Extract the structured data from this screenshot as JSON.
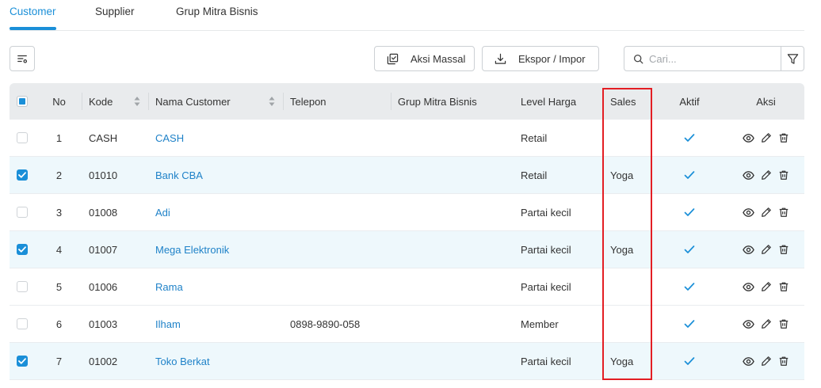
{
  "tabs": [
    {
      "label": "Customer",
      "active": true
    },
    {
      "label": "Supplier",
      "active": false
    },
    {
      "label": "Grup Mitra Bisnis",
      "active": false
    }
  ],
  "toolbar": {
    "column_settings": {
      "icon": "table-settings-icon"
    },
    "bulk_action": {
      "label": "Aksi Massal",
      "icon": "bulk-action-icon"
    },
    "export_import": {
      "label": "Ekspor / Impor",
      "icon": "download-icon"
    },
    "search": {
      "placeholder": "Cari...",
      "value": "",
      "icon": "search-icon"
    },
    "filter": {
      "icon": "filter-icon"
    }
  },
  "table": {
    "header_checkbox": {
      "checked": false,
      "indeterminate": true
    },
    "columns": [
      {
        "label": "No",
        "sortable": false
      },
      {
        "label": "Kode",
        "sortable": true
      },
      {
        "label": "Nama Customer",
        "sortable": true
      },
      {
        "label": "Telepon",
        "sortable": false
      },
      {
        "label": "Grup Mitra Bisnis",
        "sortable": false
      },
      {
        "label": "Level Harga",
        "sortable": false
      },
      {
        "label": "Sales",
        "sortable": false
      },
      {
        "label": "Aktif",
        "sortable": false
      },
      {
        "label": "Aksi",
        "sortable": false
      }
    ],
    "active_icon": "check-icon",
    "action_icons": [
      "eye-icon",
      "pencil-icon",
      "trash-icon"
    ],
    "rows": [
      {
        "selected": false,
        "no": "1",
        "kode": "CASH",
        "nama": "CASH",
        "telepon": "",
        "grup": "",
        "level_harga": "Retail",
        "sales": "",
        "aktif": true
      },
      {
        "selected": true,
        "no": "2",
        "kode": "01010",
        "nama": "Bank CBA",
        "telepon": "",
        "grup": "",
        "level_harga": "Retail",
        "sales": "Yoga",
        "aktif": true
      },
      {
        "selected": false,
        "no": "3",
        "kode": "01008",
        "nama": "Adi",
        "telepon": "",
        "grup": "",
        "level_harga": "Partai kecil",
        "sales": "",
        "aktif": true
      },
      {
        "selected": true,
        "no": "4",
        "kode": "01007",
        "nama": "Mega Elektronik",
        "telepon": "",
        "grup": "",
        "level_harga": "Partai kecil",
        "sales": "Yoga",
        "aktif": true
      },
      {
        "selected": false,
        "no": "5",
        "kode": "01006",
        "nama": "Rama",
        "telepon": "",
        "grup": "",
        "level_harga": "Partai kecil",
        "sales": "",
        "aktif": true
      },
      {
        "selected": false,
        "no": "6",
        "kode": "01003",
        "nama": "Ilham",
        "telepon": "0898-9890-058",
        "grup": "",
        "level_harga": "Member",
        "sales": "",
        "aktif": true
      },
      {
        "selected": true,
        "no": "7",
        "kode": "01002",
        "nama": "Toko Berkat",
        "telepon": "",
        "grup": "",
        "level_harga": "Partai kecil",
        "sales": "Yoga",
        "aktif": true
      }
    ]
  },
  "colors": {
    "accent": "#1a8fd8",
    "link": "#1f82c8",
    "header_bg": "#e9ebed",
    "selected_row_bg": "#eef8fc",
    "highlight_border": "#e31e24"
  }
}
